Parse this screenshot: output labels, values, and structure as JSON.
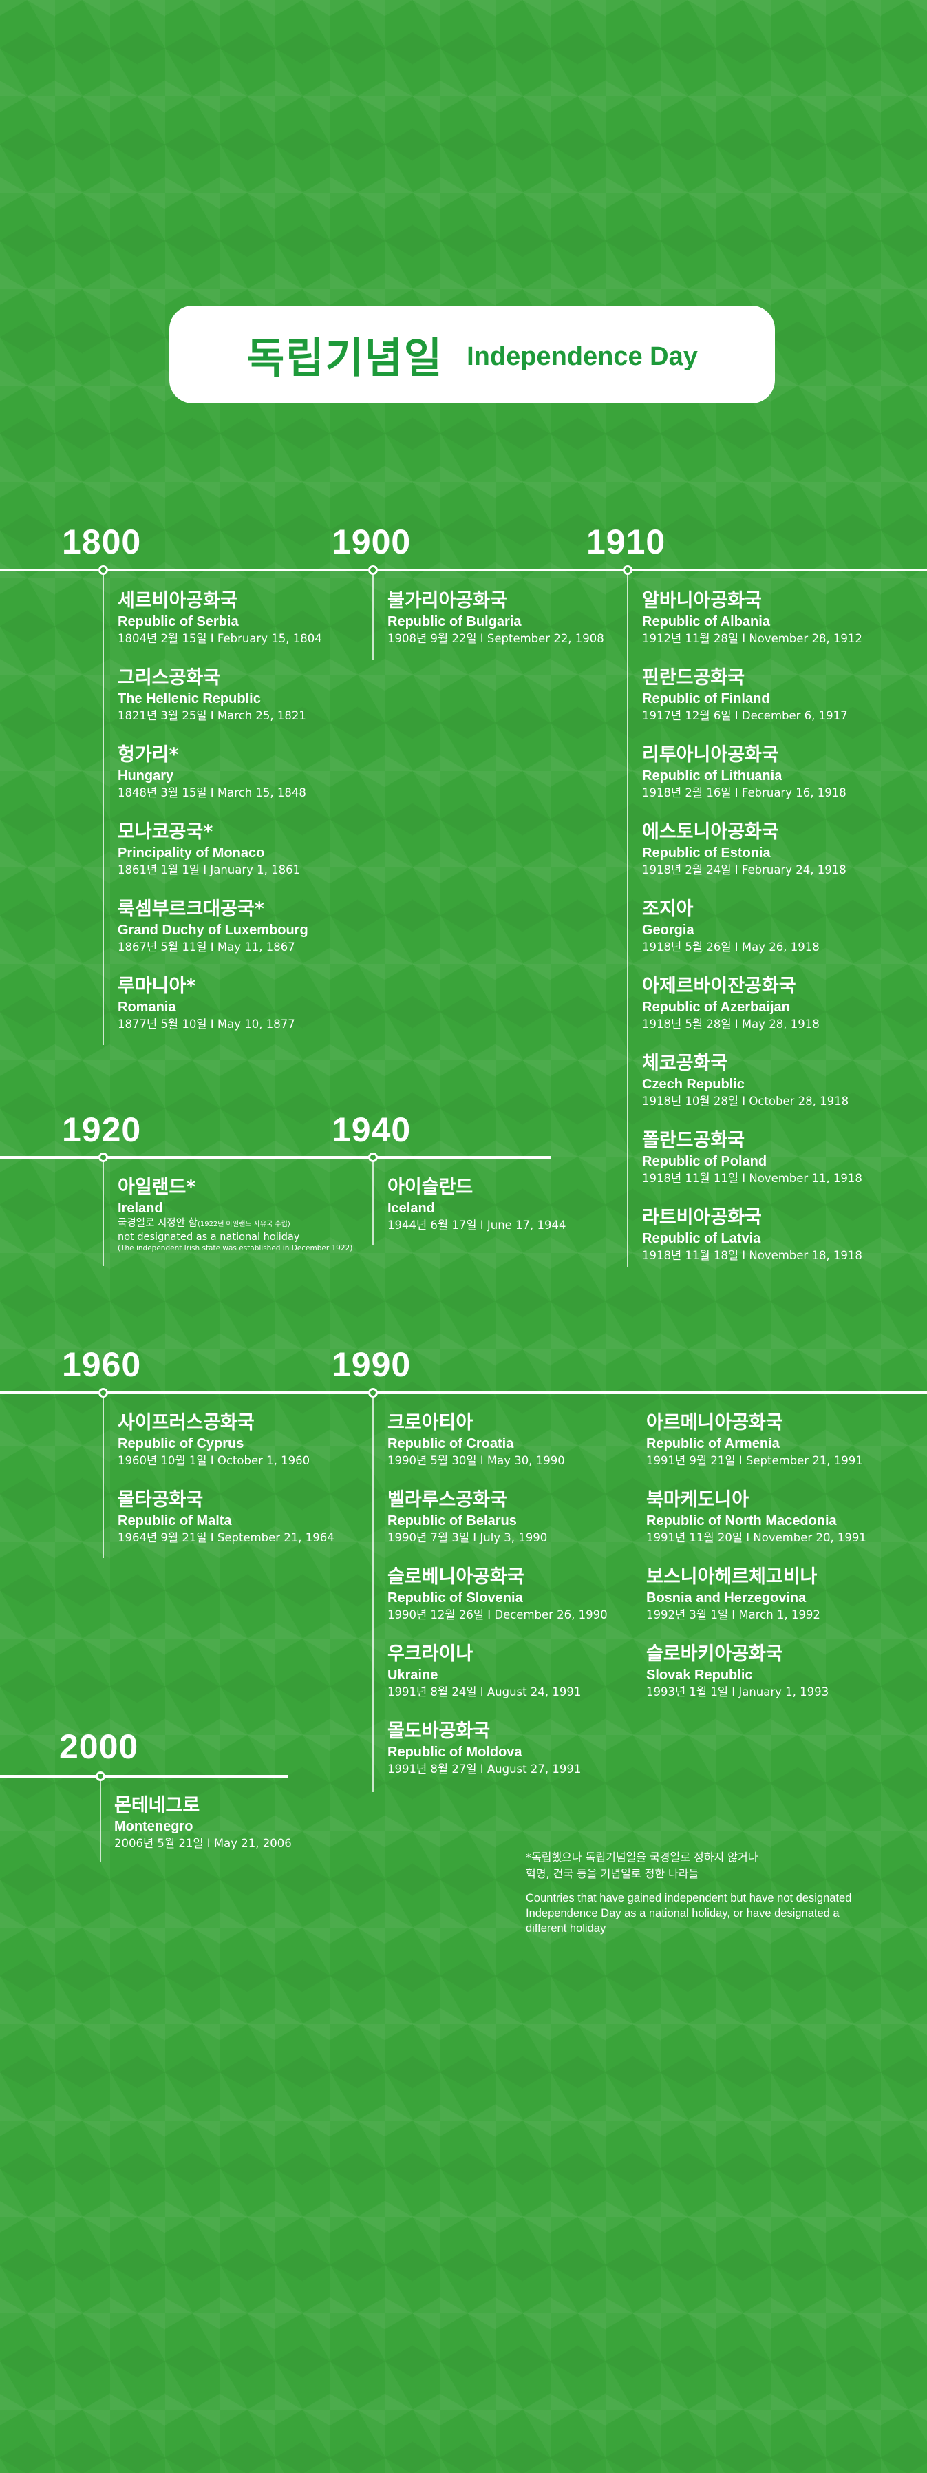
{
  "title": {
    "korean": "독립기념일",
    "english": "Independence Day"
  },
  "years": {
    "y1800": "1800",
    "y1900": "1900",
    "y1910": "1910",
    "y1920": "1920",
    "y1940": "1940",
    "y1960": "1960",
    "y1990": "1990",
    "y2000": "2000"
  },
  "entries": {
    "serbia": {
      "ko": "세르비아공화국",
      "en": "Republic of Serbia",
      "date": "1804년 2월 15일 I February 15, 1804"
    },
    "greece": {
      "ko": "그리스공화국",
      "en": "The Hellenic Republic",
      "date": "1821년 3월 25일 I March 25, 1821"
    },
    "hungary": {
      "ko": "헝가리*",
      "en": "Hungary",
      "date": "1848년 3월 15일 I March 15, 1848"
    },
    "monaco": {
      "ko": "모나코공국*",
      "en": "Principality of Monaco",
      "date": "1861년 1월 1일 I January 1, 1861"
    },
    "luxembourg": {
      "ko": "룩셈부르크대공국*",
      "en": "Grand Duchy of Luxembourg",
      "date": "1867년 5월 11일 I May 11, 1867"
    },
    "romania": {
      "ko": "루마니아*",
      "en": "Romania",
      "date": "1877년 5월 10일 I May 10, 1877"
    },
    "bulgaria": {
      "ko": "불가리아공화국",
      "en": "Republic of Bulgaria",
      "date": "1908년 9월 22일 I September 22, 1908"
    },
    "albania": {
      "ko": "알바니아공화국",
      "en": "Republic of Albania",
      "date": "1912년 11월 28일 I November 28, 1912"
    },
    "finland": {
      "ko": "핀란드공화국",
      "en": "Republic of Finland",
      "date": "1917년 12월 6일 I December 6, 1917"
    },
    "lithuania": {
      "ko": "리투아니아공화국",
      "en": "Republic of Lithuania",
      "date": "1918년 2월 16일 I February 16, 1918"
    },
    "estonia": {
      "ko": "에스토니아공화국",
      "en": "Republic of Estonia",
      "date": "1918년 2월 24일 I February 24, 1918"
    },
    "georgia": {
      "ko": "조지아",
      "en": "Georgia",
      "date": "1918년 5월 26일 I May 26, 1918"
    },
    "azerbaijan": {
      "ko": "아제르바이잔공화국",
      "en": "Republic of Azerbaijan",
      "date": "1918년 5월 28일 I May 28, 1918"
    },
    "czech": {
      "ko": "체코공화국",
      "en": "Czech Republic",
      "date": "1918년 10월 28일 I October 28, 1918"
    },
    "poland": {
      "ko": "폴란드공화국",
      "en": "Republic of Poland",
      "date": "1918년 11월 11일 I November 11, 1918"
    },
    "latvia": {
      "ko": "라트비아공화국",
      "en": "Republic of Latvia",
      "date": "1918년 11월 18일 I November 18, 1918"
    },
    "ireland": {
      "ko": "아일랜드*",
      "en": "Ireland",
      "note_ko": "국경일로 지정안 함",
      "note_ko_small": "(1922년 아일랜드 자유국 수립)",
      "note_en": "not designated as a national holiday",
      "note_en_small": "(The independent Irish state was established in December 1922)"
    },
    "iceland": {
      "ko": "아이슬란드",
      "en": "Iceland",
      "date": "1944년 6월 17일 I June 17, 1944"
    },
    "cyprus": {
      "ko": "사이프러스공화국",
      "en": "Republic of Cyprus",
      "date": "1960년 10월 1일 I October 1, 1960"
    },
    "malta": {
      "ko": "몰타공화국",
      "en": "Republic of Malta",
      "date": "1964년 9월 21일 I September 21, 1964"
    },
    "croatia": {
      "ko": "크로아티아",
      "en": "Republic of Croatia",
      "date": "1990년 5월 30일 I May 30, 1990"
    },
    "belarus": {
      "ko": "벨라루스공화국",
      "en": "Republic of Belarus",
      "date": "1990년 7월 3일 I July 3, 1990"
    },
    "slovenia": {
      "ko": "슬로베니아공화국",
      "en": "Republic of Slovenia",
      "date": "1990년 12월 26일 I December 26, 1990"
    },
    "ukraine": {
      "ko": "우크라이나",
      "en": "Ukraine",
      "date": "1991년 8월 24일 I August 24, 1991"
    },
    "moldova": {
      "ko": "몰도바공화국",
      "en": "Republic of Moldova",
      "date": "1991년 8월 27일 I August 27, 1991"
    },
    "armenia": {
      "ko": "아르메니아공화국",
      "en": "Republic of Armenia",
      "date": "1991년 9월 21일 I September 21, 1991"
    },
    "macedonia": {
      "ko": "북마케도니아",
      "en": "Republic of North Macedonia",
      "date": "1991년 11월 20일 I November 20, 1991"
    },
    "bosnia": {
      "ko": "보스니아헤르체고비나",
      "en": "Bosnia and Herzegovina",
      "date": "1992년 3월 1일 I March 1, 1992"
    },
    "slovakia": {
      "ko": "슬로바키아공화국",
      "en": "Slovak Republic",
      "date": "1993년 1월 1일 I January 1, 1993"
    },
    "montenegro": {
      "ko": "몬테네그로",
      "en": "Montenegro",
      "date": "2006년 5월 21일 I May 21, 2006"
    }
  },
  "footnote": {
    "korean": "*독립했으나 독립기념일을 국경일로 정하지 않거나\n혁명, 건국 등을 기념일로 정한 나라들",
    "english": "Countries that have gained independent but have not designated Independence Day as a national holiday, or have designated a different holiday"
  },
  "colors": {
    "background": "#3aa43a",
    "title_text": "#1e9a3a",
    "line": "#ffffff"
  }
}
